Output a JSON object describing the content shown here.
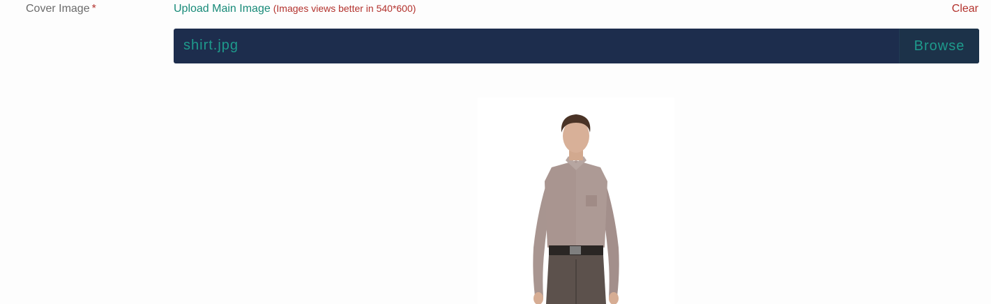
{
  "field": {
    "label": "Cover Image",
    "required_mark": "*"
  },
  "upload": {
    "title": "Upload Main Image",
    "hint": "(Images views better in 540*600)",
    "clear_label": "Clear"
  },
  "file_input": {
    "value": "shirt.jpg",
    "browse_label": "Browse"
  },
  "preview": {
    "subject": "man-in-shirt-photo"
  },
  "colors": {
    "accent": "#178a78",
    "error": "#b3322d",
    "input_bg": "#1d2d4d"
  }
}
